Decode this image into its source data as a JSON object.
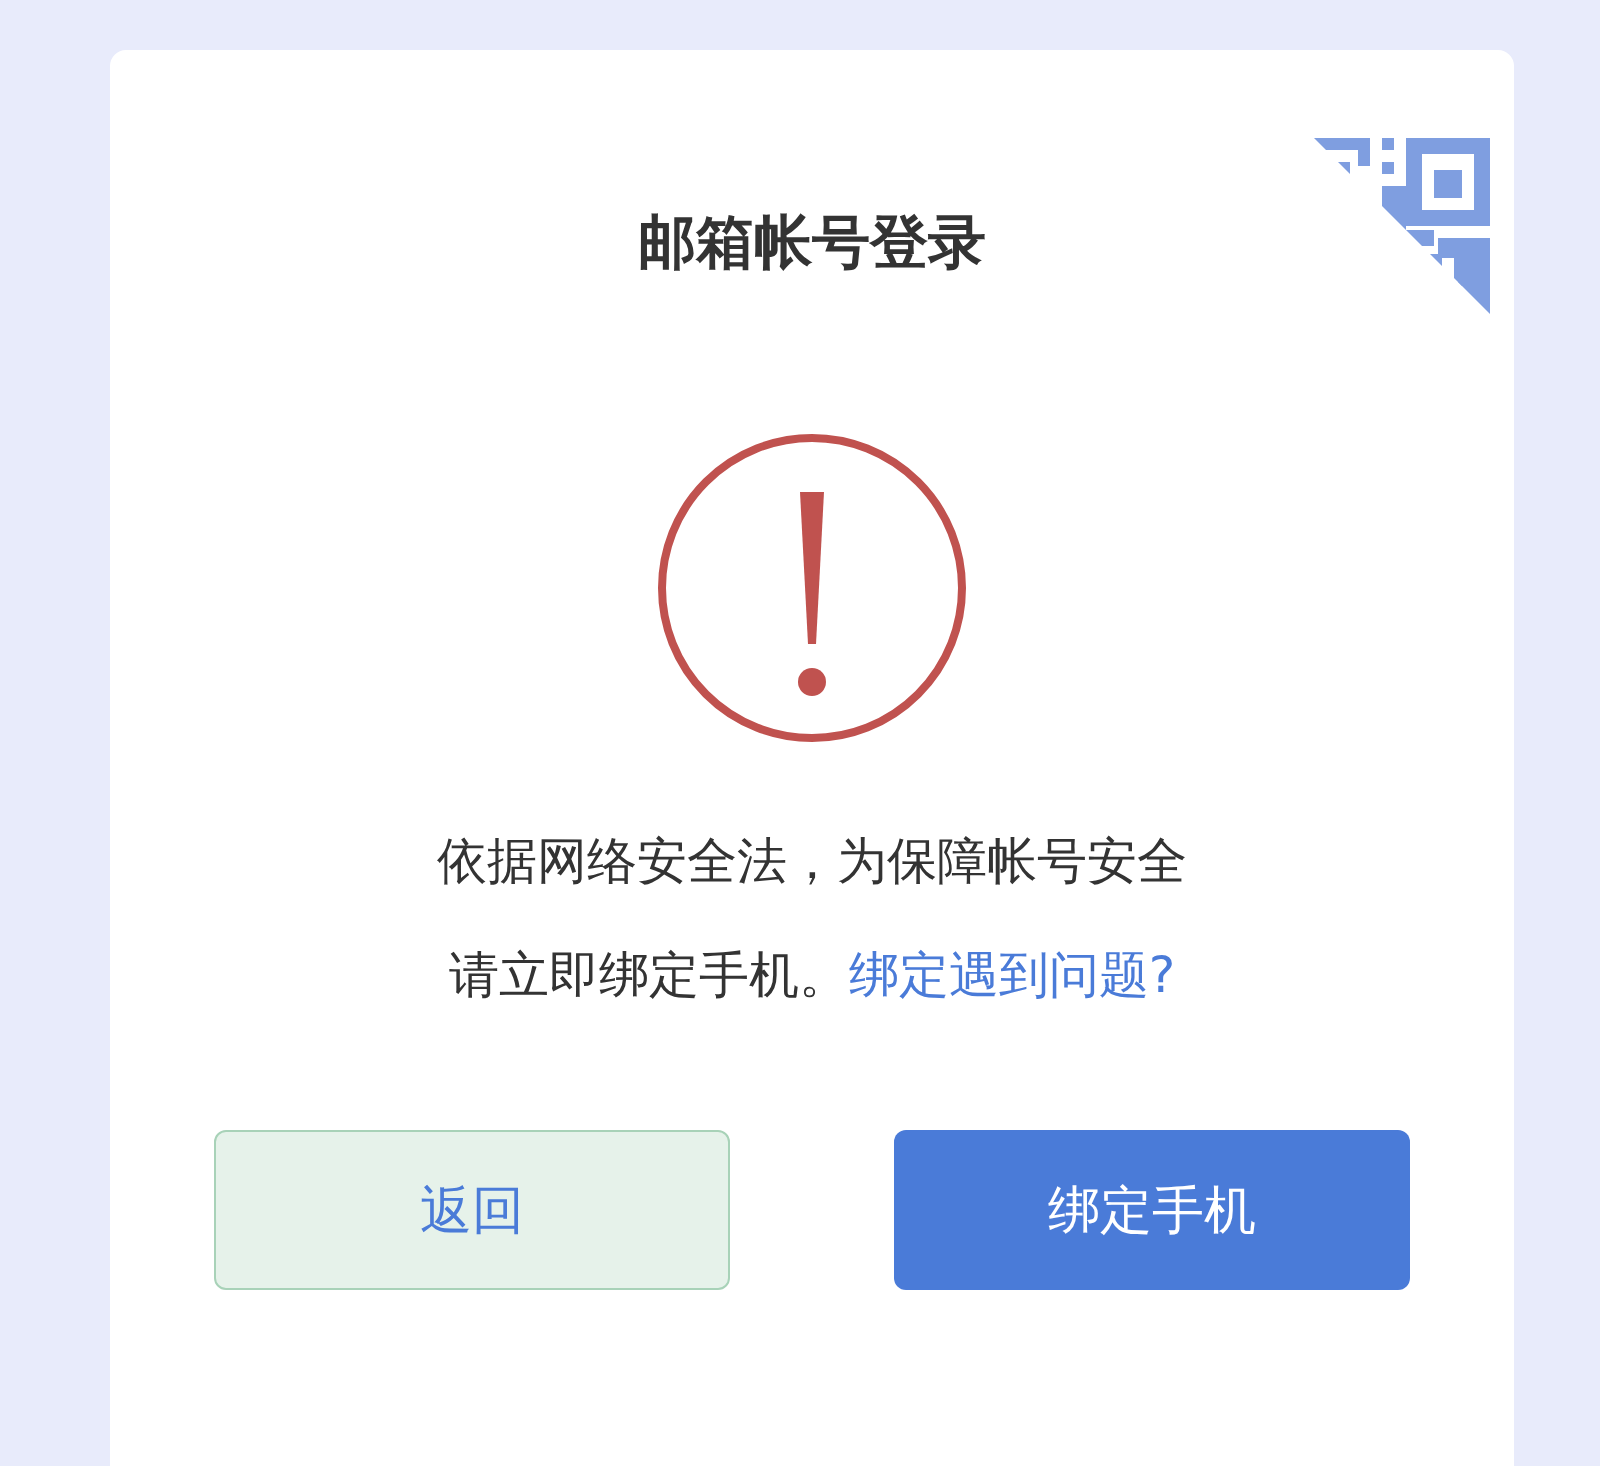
{
  "card": {
    "title": "邮箱帐号登录"
  },
  "notice": {
    "line_1": "依据网络安全法，为保障帐号安全",
    "line_2": "请立即绑定手机。",
    "link": "绑定遇到问题?"
  },
  "buttons": [
    {
      "label": "返回",
      "kind": "secondary"
    },
    {
      "label": "绑定手机",
      "kind": "primary"
    }
  ]
}
